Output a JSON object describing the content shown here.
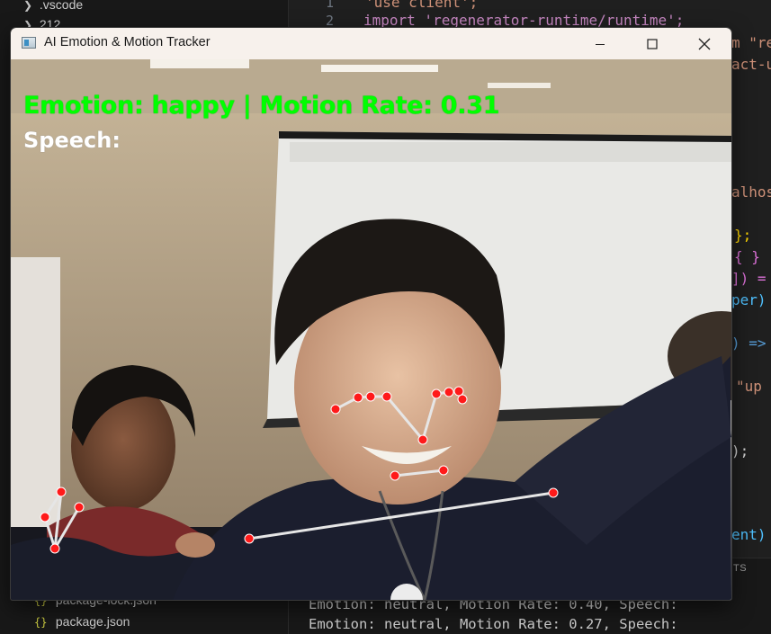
{
  "explorer": {
    "items": [
      {
        "label": ".vscode",
        "icon": "chevron-right-icon"
      },
      {
        "label": "212",
        "icon": "chevron-right-icon"
      },
      {
        "label": "package-lock.json",
        "icon": "json-icon"
      },
      {
        "label": "package.json",
        "icon": "json-icon"
      }
    ]
  },
  "editor": {
    "line_numbers": [
      "1",
      "2"
    ],
    "lines": [
      {
        "text": "'use client';",
        "color": "#ce9178"
      },
      {
        "text": "import 'regenerator-runtime/runtime';",
        "color": "#c586c0"
      }
    ],
    "fragments": [
      "m \"re",
      "act-u",
      "alhost",
      "};",
      "{ }",
      "]) =",
      "per) =",
      ") =>",
      "\"up a",
      ");",
      "ent) ="
    ]
  },
  "terminal": {
    "tab_label": "TS",
    "lines": [
      "Emotion: neutral, Motion Rate: 0.40, Speech:",
      "Emotion: neutral, Motion Rate: 0.27, Speech:"
    ]
  },
  "window": {
    "title": "AI Emotion & Motion Tracker",
    "controls": [
      "minimize-icon",
      "maximize-icon",
      "close-icon"
    ]
  },
  "video": {
    "emotion_overlay": "Emotion: happy | Motion Rate: 0.31",
    "speech_overlay": "Speech:",
    "overlay_colors": {
      "emotion": "#00ff00",
      "speech": "#ffffff",
      "landmark": "#ff0000",
      "link": "#e6e6e6"
    }
  }
}
